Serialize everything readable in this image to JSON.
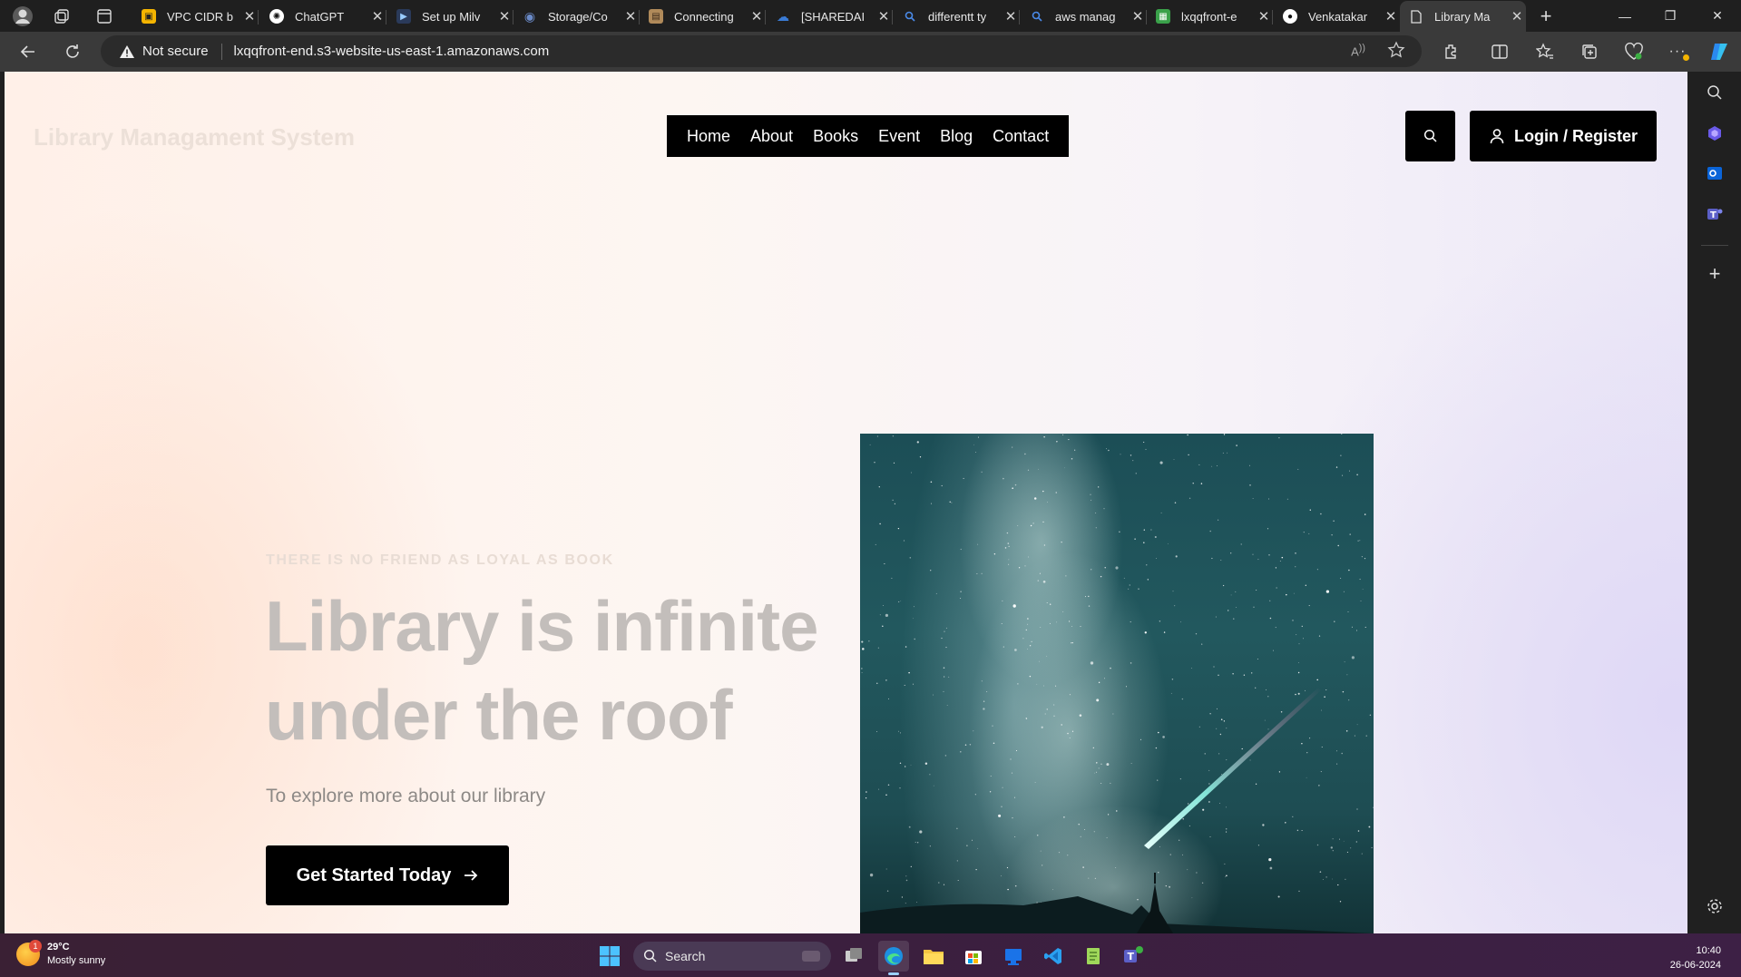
{
  "browser": {
    "tabs": [
      {
        "title": "VPC CIDR b",
        "icon": "aws-icon",
        "color": "#f4b400"
      },
      {
        "title": "ChatGPT",
        "icon": "chatgpt-icon",
        "color": "#ffffff"
      },
      {
        "title": "Set up Milv",
        "icon": "video-icon",
        "color": "#2a3a5a"
      },
      {
        "title": "Storage/Co",
        "icon": "eye-icon",
        "color": "#6a8ac8"
      },
      {
        "title": "Connecting",
        "icon": "box-icon",
        "color": "#b08a5a"
      },
      {
        "title": "[SHAREDAI",
        "icon": "cloud-icon",
        "color": "#3a7bd5"
      },
      {
        "title": "differentt ty",
        "icon": "search-icon",
        "color": "#4a8ae8"
      },
      {
        "title": "aws manag",
        "icon": "search-icon",
        "color": "#4a8ae8"
      },
      {
        "title": "lxqqfront-e",
        "icon": "s3-icon",
        "color": "#3aa14a"
      },
      {
        "title": "Venkatakar",
        "icon": "github-icon",
        "color": "#ffffff"
      },
      {
        "title": "Library Ma",
        "icon": "page-icon",
        "color": "#cfcfcf",
        "active": true
      }
    ],
    "address": {
      "security": "Not secure",
      "url": "lxqqfront-end.s3-website-us-east-1.amazonaws.com"
    }
  },
  "site": {
    "logo": "Library Managament System",
    "nav": [
      "Home",
      "About",
      "Books",
      "Event",
      "Blog",
      "Contact"
    ],
    "login_label": "Login / Register"
  },
  "hero": {
    "eyebrow": "THERE IS NO FRIEND AS LOYAL AS BOOK",
    "title_line1": "Library is infinite",
    "title_line2": "under the roof",
    "subtitle": "To explore more about our library",
    "cta_label": "Get Started Today",
    "image": "night-sky-milky-way-meteor"
  },
  "taskbar": {
    "weather": {
      "temp": "29°C",
      "desc": "Mostly sunny",
      "badge": "1"
    },
    "search_placeholder": "Search",
    "time": "10:40",
    "date": "26-06-2024"
  },
  "colors": {
    "accent": "#000000",
    "page_bg_warm": "#fff0e8",
    "page_bg_cool": "#ece8f7"
  }
}
